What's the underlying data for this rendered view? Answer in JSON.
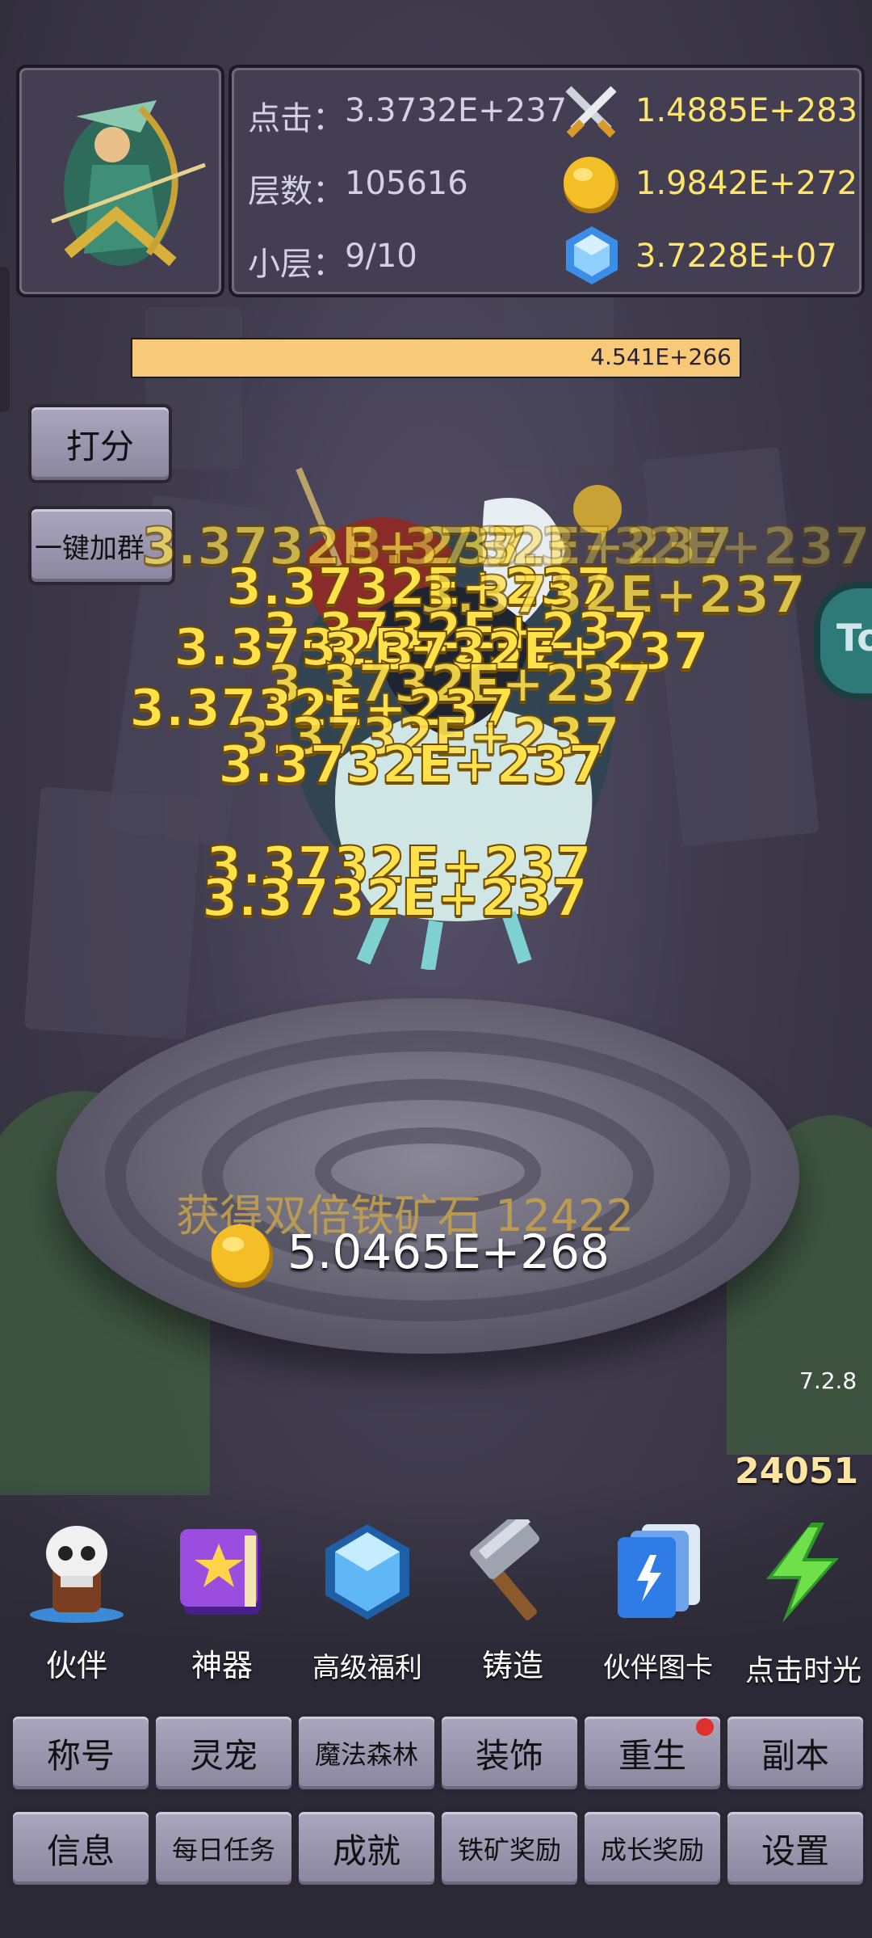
{
  "stats": {
    "click_label": "点击：",
    "click_value": "3.3732E+237",
    "floor_label": "层数：",
    "floor_value": "105616",
    "subfloor_label": "小层：",
    "subfloor_value": "9/10",
    "attack_value": "1.4885E+283",
    "gold_value": "1.9842E+272",
    "gem_value": "3.7228E+07"
  },
  "boss_hp": {
    "text": "4.541E+266",
    "fraction": 1.0
  },
  "side_buttons": {
    "score": "打分",
    "join_group": "一键加群"
  },
  "damage_numbers": [
    "3.3732E+237",
    "3.3732E+237",
    "3.3732E+237",
    "3.3732E+237",
    "3.3732E+237",
    "3.3732E+237",
    "3.3732E+237",
    "3.3732E+237",
    "3.3732E+237",
    "3.3732E+237",
    "3.3732E+237",
    "3.3732E+237",
    "3.3732E+237",
    "3.3732E+237"
  ],
  "reward": {
    "ore_text": "获得双倍铁矿石 12422",
    "gold_drop": "5.0465E+268"
  },
  "version": "7.2.8",
  "counter": "24051",
  "menu": [
    {
      "label": "伙伴",
      "icon": "skull-partner-icon"
    },
    {
      "label": "神器",
      "icon": "spellbook-icon"
    },
    {
      "label": "高级福利",
      "icon": "diamond-icon"
    },
    {
      "label": "铸造",
      "icon": "hammer-icon"
    },
    {
      "label": "伙伴图卡",
      "icon": "cards-icon"
    },
    {
      "label": "点击时光",
      "icon": "lightning-icon"
    }
  ],
  "grid_row1": [
    "称号",
    "灵宠",
    "魔法森林",
    "装饰",
    "重生",
    "副本"
  ],
  "grid_row2": [
    "信息",
    "每日任务",
    "成就",
    "铁矿奖励",
    "成长奖励",
    "设置"
  ],
  "colors": {
    "hp_bar": "#f7c978",
    "value_text": "#ffe66b",
    "notification_dot": "#e03030"
  }
}
